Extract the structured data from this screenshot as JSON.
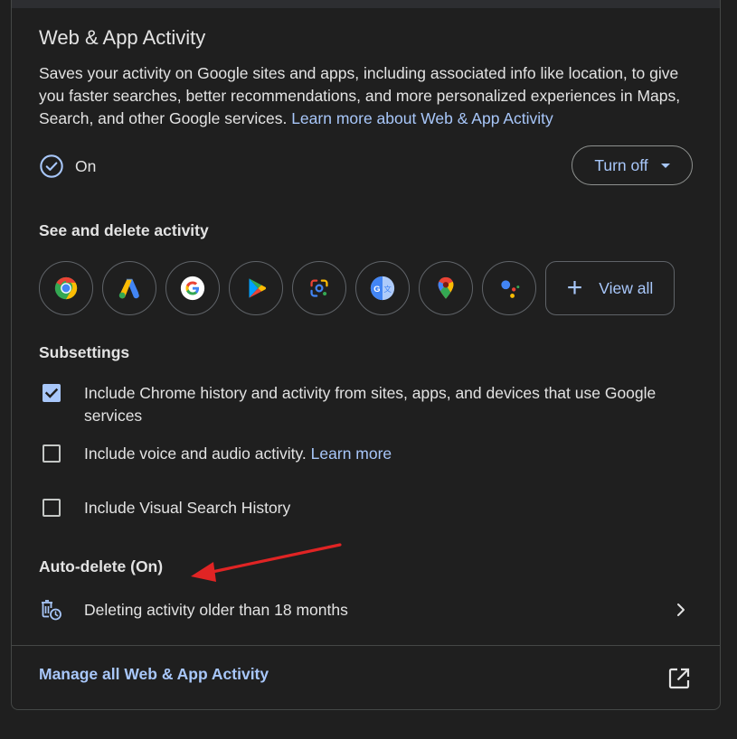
{
  "card": {
    "title": "Web & App Activity",
    "description": "Saves your activity on Google sites and apps, including associated info like location, to give you faster searches, better recommendations, and more personalized experiences in Maps, Search, and other Google services.",
    "learn_more_link": "Learn more about Web & App Activity",
    "status_icon": "check-circle-icon",
    "status_text": "On",
    "turn_off_label": "Turn off"
  },
  "activity": {
    "heading": "See and delete activity",
    "apps": [
      {
        "name": "Chrome",
        "icon": "chrome-icon"
      },
      {
        "name": "Google Ads",
        "icon": "google-ads-icon"
      },
      {
        "name": "Google Search",
        "icon": "google-g-icon"
      },
      {
        "name": "Google Play",
        "icon": "google-play-icon"
      },
      {
        "name": "Google Lens",
        "icon": "google-lens-icon"
      },
      {
        "name": "Google Translate",
        "icon": "google-translate-icon"
      },
      {
        "name": "Google Maps",
        "icon": "google-maps-icon"
      },
      {
        "name": "Google Assistant",
        "icon": "google-assistant-icon"
      }
    ],
    "view_all_label": "View all"
  },
  "subsettings": {
    "heading": "Subsettings",
    "items": [
      {
        "label": "Include Chrome history and activity from sites, apps, and devices that use Google services",
        "checked": true,
        "link": ""
      },
      {
        "label": "Include voice and audio activity.",
        "checked": false,
        "link": "Learn more"
      },
      {
        "label": "Include Visual Search History",
        "checked": false,
        "link": ""
      }
    ]
  },
  "auto_delete": {
    "heading": "Auto-delete (On)",
    "row_text": "Deleting activity older than 18 months",
    "row_icon": "auto-delete-icon"
  },
  "footer": {
    "manage_link": "Manage all Web & App Activity",
    "external_icon": "open-in-new-icon"
  },
  "colors": {
    "background": "#1f1f1f",
    "link": "#a8c7fa",
    "text": "#e3e3e3",
    "border": "#444746",
    "annotation_arrow": "#e02424"
  }
}
